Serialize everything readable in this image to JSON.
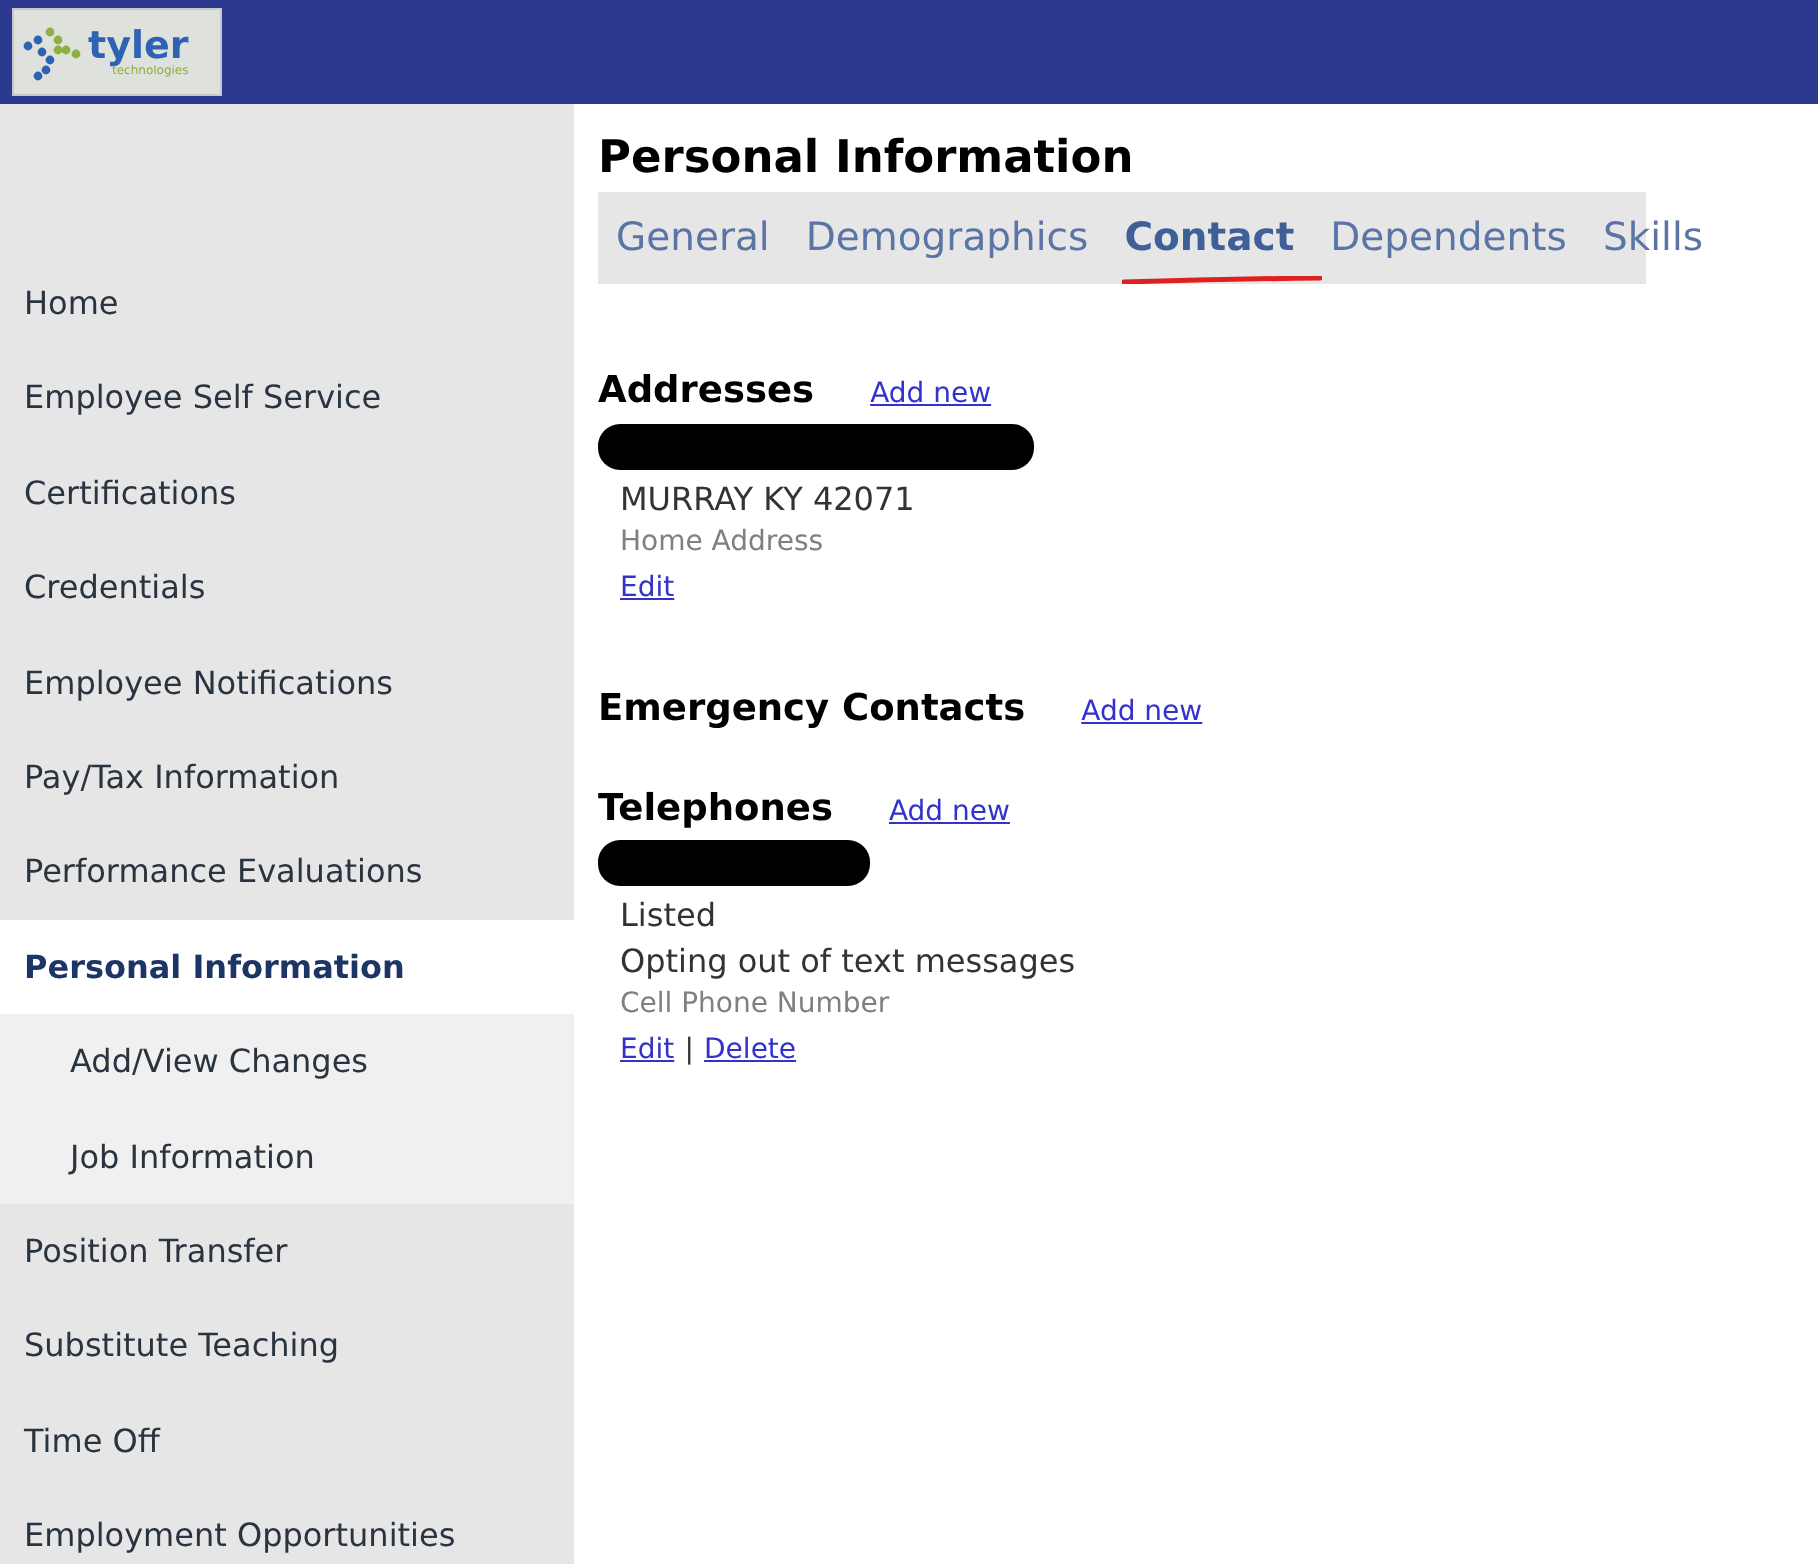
{
  "header": {
    "logo": {
      "word": "tyler",
      "subword": "technologies"
    }
  },
  "sidebar": {
    "items": [
      {
        "label": "Home",
        "selected": false
      },
      {
        "label": "Employee Self Service",
        "selected": false
      },
      {
        "label": "Certifications",
        "selected": false
      },
      {
        "label": "Credentials",
        "selected": false
      },
      {
        "label": "Employee Notifications",
        "selected": false
      },
      {
        "label": "Pay/Tax Information",
        "selected": false
      },
      {
        "label": "Performance Evaluations",
        "selected": false
      },
      {
        "label": "Personal Information",
        "selected": true,
        "children": [
          {
            "label": "Add/View Changes",
            "selected": false
          },
          {
            "label": "Job Information",
            "selected": false
          }
        ]
      },
      {
        "label": "Position Transfer",
        "selected": false
      },
      {
        "label": "Substitute Teaching",
        "selected": false
      },
      {
        "label": "Time Off",
        "selected": false
      },
      {
        "label": "Employment Opportunities",
        "selected": false
      }
    ]
  },
  "page": {
    "title": "Personal Information",
    "tabs": [
      {
        "label": "General",
        "selected": false
      },
      {
        "label": "Demographics",
        "selected": false
      },
      {
        "label": "Contact",
        "selected": true
      },
      {
        "label": "Dependents",
        "selected": false
      },
      {
        "label": "Skills",
        "selected": false
      }
    ],
    "sections": [
      {
        "heading": "Addresses",
        "add_link": "Add new",
        "entries": [
          {
            "redacted": true,
            "lines": [
              "MURRAY KY 42071"
            ],
            "type_label": "Home Address",
            "actions": [
              "Edit"
            ]
          }
        ]
      },
      {
        "heading": "Emergency Contacts",
        "add_link": "Add new"
      },
      {
        "heading": "Telephones",
        "add_link": "Add new",
        "entries": [
          {
            "redacted": true,
            "lines": [
              "Listed",
              "Opting out of text messages"
            ],
            "type_label": "Cell Phone Number",
            "actions": [
              "Edit",
              "Delete"
            ],
            "separator": "|"
          }
        ]
      }
    ]
  }
}
